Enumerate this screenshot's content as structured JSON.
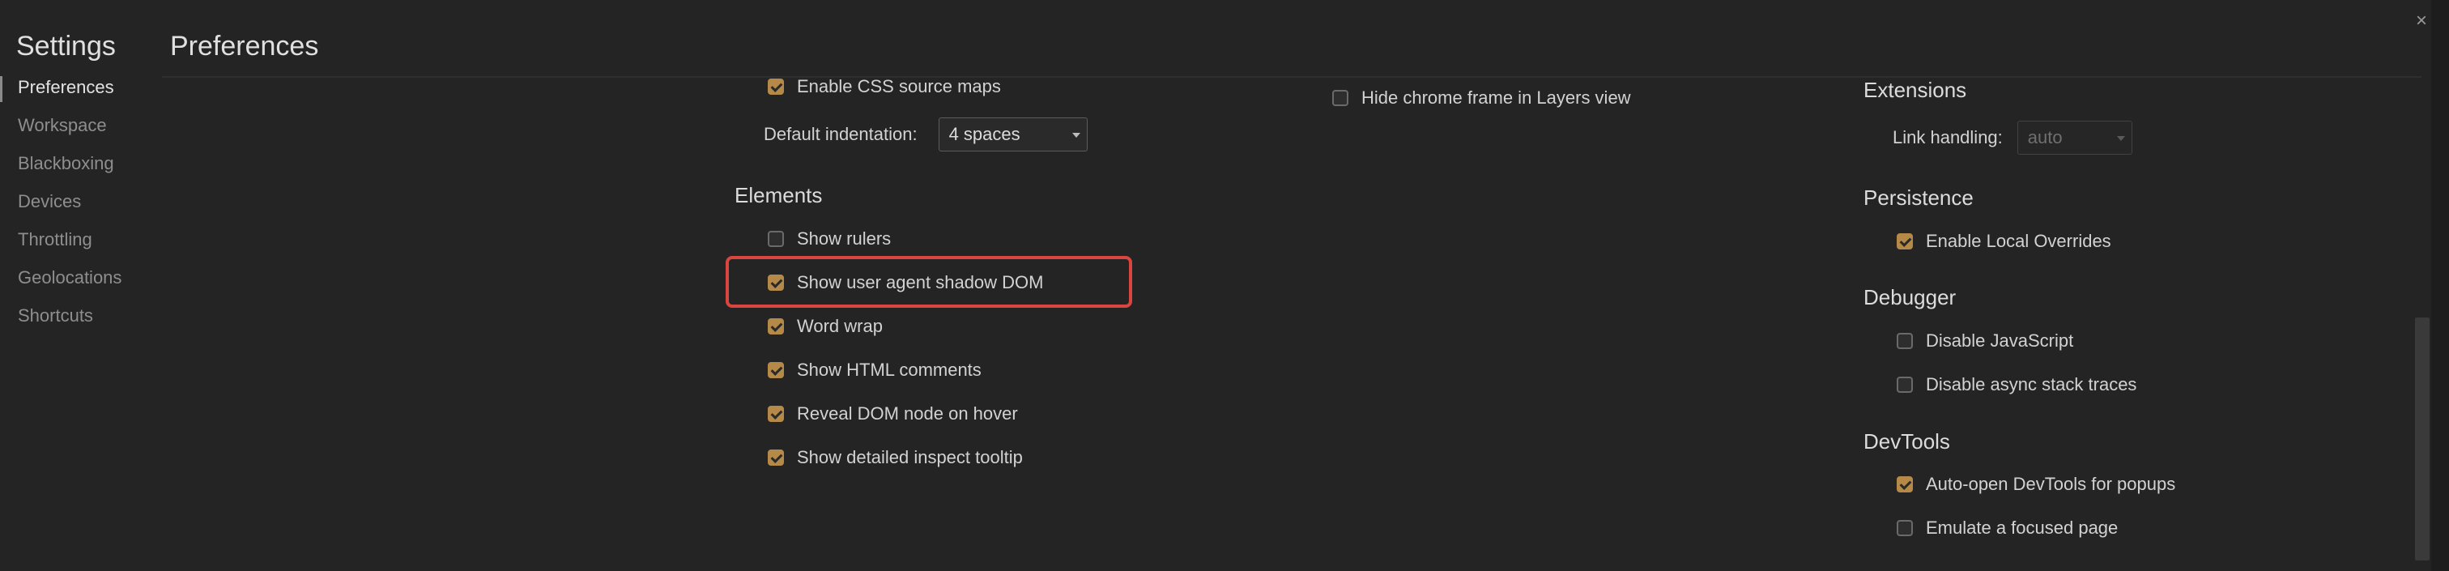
{
  "header": {
    "settings_title": "Settings",
    "page_title": "Preferences",
    "close_label": "×"
  },
  "sidebar": {
    "items": [
      {
        "label": "Preferences",
        "active": true
      },
      {
        "label": "Workspace"
      },
      {
        "label": "Blackboxing"
      },
      {
        "label": "Devices"
      },
      {
        "label": "Throttling"
      },
      {
        "label": "Geolocations"
      },
      {
        "label": "Shortcuts"
      }
    ]
  },
  "column1": {
    "source_maps": {
      "label": "Enable CSS source maps",
      "checked": true
    },
    "default_indentation": {
      "label": "Default indentation:",
      "value": "4 spaces"
    },
    "elements": {
      "heading": "Elements",
      "options": [
        {
          "label": "Show rulers",
          "checked": false
        },
        {
          "label": "Show user agent shadow DOM",
          "checked": true
        },
        {
          "label": "Word wrap",
          "checked": true
        },
        {
          "label": "Show HTML comments",
          "checked": true
        },
        {
          "label": "Reveal DOM node on hover",
          "checked": true
        },
        {
          "label": "Show detailed inspect tooltip",
          "checked": true
        }
      ]
    }
  },
  "column2": {
    "hide_chrome_frame": {
      "label": "Hide chrome frame in Layers view",
      "checked": false
    }
  },
  "column3": {
    "extensions": {
      "heading": "Extensions",
      "link_handling": {
        "label": "Link handling:",
        "value": "auto"
      }
    },
    "persistence": {
      "heading": "Persistence",
      "options": [
        {
          "label": "Enable Local Overrides",
          "checked": true
        }
      ]
    },
    "debugger": {
      "heading": "Debugger",
      "options": [
        {
          "label": "Disable JavaScript",
          "checked": false
        },
        {
          "label": "Disable async stack traces",
          "checked": false
        }
      ]
    },
    "devtools": {
      "heading": "DevTools",
      "options": [
        {
          "label": "Auto-open DevTools for popups",
          "checked": true
        },
        {
          "label": "Emulate a focused page",
          "checked": false
        }
      ]
    }
  },
  "colors": {
    "background": "#242424",
    "checkbox_checked": "#b58a48",
    "highlight": "#d9453f"
  }
}
